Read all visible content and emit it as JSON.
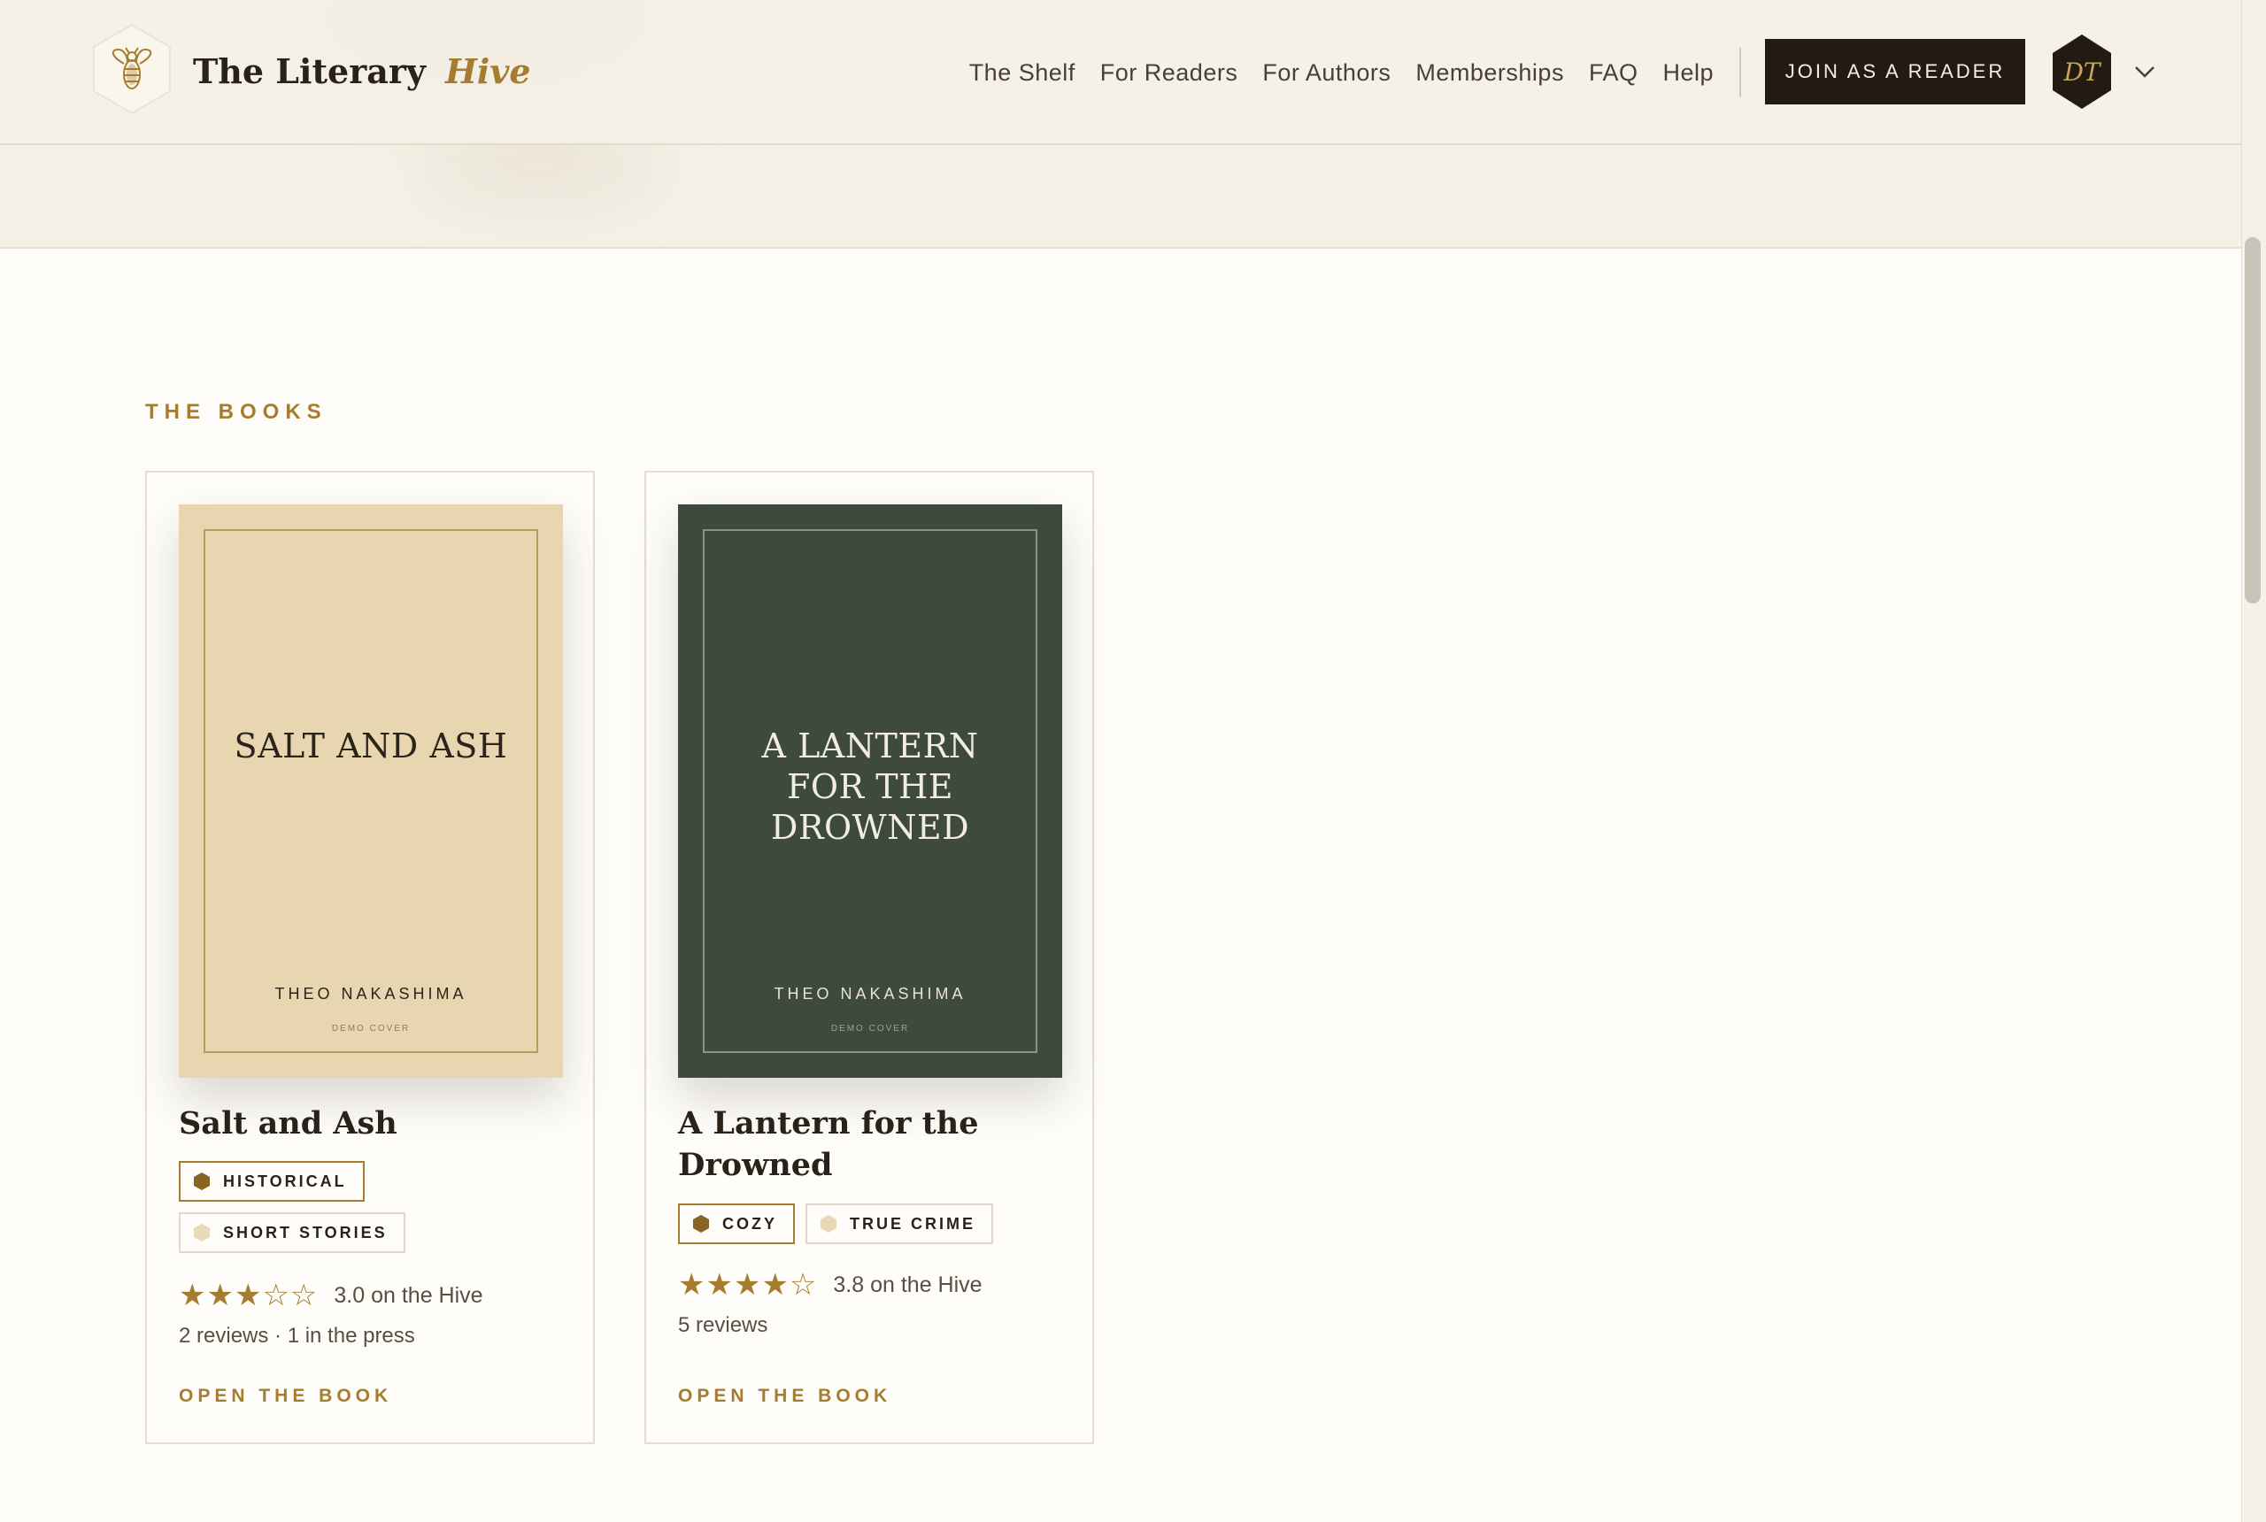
{
  "brand": {
    "name": "The Literary",
    "accent": "Hive"
  },
  "nav": {
    "links": [
      "The Shelf",
      "For Readers",
      "For Authors",
      "Memberships",
      "FAQ",
      "Help"
    ],
    "join_label": "JOIN AS A READER",
    "avatar_initials": "DT"
  },
  "section": {
    "label": "THE BOOKS"
  },
  "books": [
    {
      "cover_title": "SALT AND ASH",
      "cover_author": "THEO NAKASHIMA",
      "cover_note": "DEMO COVER",
      "cover_color": "#e8d6b0",
      "title": "Salt and Ash",
      "tags": [
        "HISTORICAL",
        "SHORT STORIES"
      ],
      "stars": "★★★☆☆",
      "rating": 3.0,
      "rating_text": "3.0 on the Hive",
      "meta": "2 reviews · 1 in the press",
      "link": "OPEN THE BOOK"
    },
    {
      "cover_title": "A LANTERN FOR THE DROWNED",
      "cover_author": "THEO NAKASHIMA",
      "cover_note": "DEMO COVER",
      "cover_color": "#3e4a3e",
      "title": "A Lantern for the Drowned",
      "tags": [
        "COZY",
        "TRUE CRIME"
      ],
      "stars": "★★★★☆",
      "rating": 3.8,
      "rating_text": "3.8 on the Hive",
      "meta": "5 reviews",
      "link": "OPEN THE BOOK"
    }
  ],
  "colors": {
    "accent": "#a67c2e",
    "dark": "#231a14",
    "background": "#fdfcf8"
  },
  "icons": {
    "logo": "bee-hexagon-icon",
    "avatar": "hexagon-avatar",
    "chevron": "chevron-down-icon"
  }
}
